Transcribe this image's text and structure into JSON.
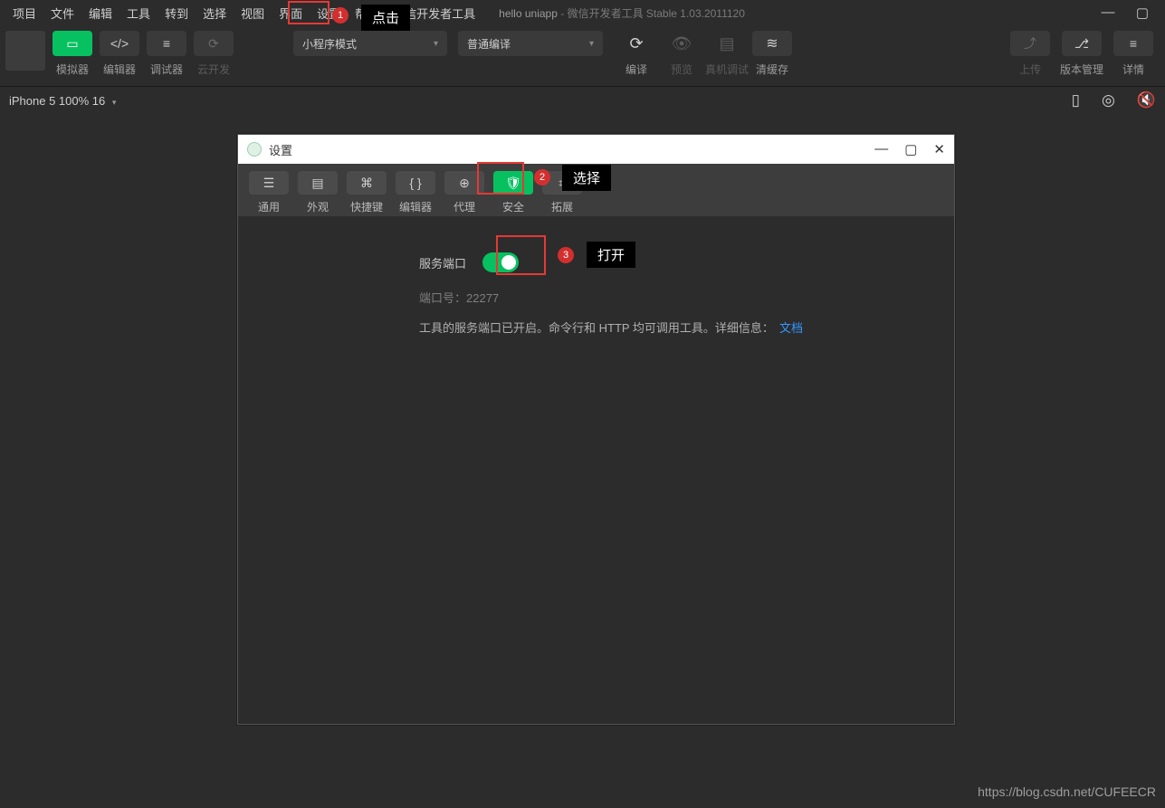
{
  "menubar": {
    "items": [
      "项目",
      "文件",
      "编辑",
      "工具",
      "转到",
      "选择",
      "视图",
      "界面",
      "设置",
      "帮助",
      "微信开发者工具"
    ],
    "app_name": "hello uniapp",
    "app_sub": " - 微信开发者工具 Stable 1.03.2011120"
  },
  "toolbar": {
    "simulator_label": "模拟器",
    "editor_label": "编辑器",
    "debugger_label": "调试器",
    "clouddev_label": "云开发",
    "mode_select": "小程序模式",
    "compile_select": "普通编译",
    "compile_label": "编译",
    "preview_label": "预览",
    "remote_debug_label": "真机调试",
    "clear_cache_label": "清缓存",
    "upload_label": "上传",
    "version_label": "版本管理",
    "details_label": "详情"
  },
  "statusbar": {
    "device": "iPhone 5 100% 16"
  },
  "annotations": {
    "b1": "1",
    "l1": "点击",
    "b2": "2",
    "l2": "选择",
    "b3": "3",
    "l3": "打开"
  },
  "dialog": {
    "title": "设置",
    "tabs": [
      "通用",
      "外观",
      "快捷键",
      "编辑器",
      "代理",
      "安全",
      "拓展"
    ],
    "service_port_label": "服务端口",
    "port_label": "端口号：",
    "port_value": "22277",
    "desc": "工具的服务端口已开启。命令行和 HTTP 均可调用工具。详细信息：",
    "doc_link": "文档"
  },
  "watermark": "https://blog.csdn.net/CUFEECR"
}
